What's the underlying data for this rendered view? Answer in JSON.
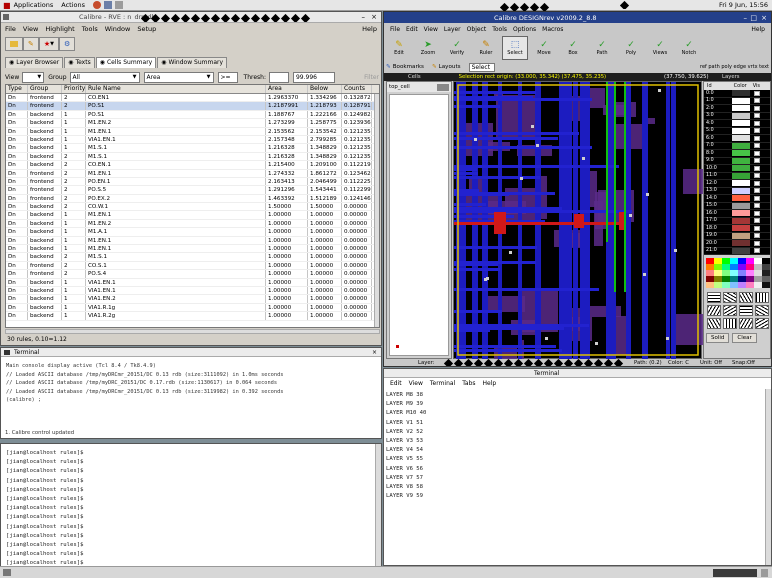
{
  "topbar": {
    "applications": "Applications",
    "actions": "Actions",
    "clock": "Fri 9 Jun, 15:56"
  },
  "rve": {
    "title": "Calibre - RVE : n",
    "title_tail": "drmdb",
    "help": "Help",
    "menu": [
      "File",
      "View",
      "Highlight",
      "Tools",
      "Window",
      "Setup"
    ],
    "tabs": [
      "Layer Browser",
      "Texts",
      "Cells Summary",
      "Window Summary"
    ],
    "filter": {
      "view_label": "View",
      "group_label": "Group",
      "group_value": "All",
      "value_col": "Area",
      "threshold_label": "Thresh:",
      "threshold_value": "99.996",
      "filter_btn": "Filter"
    },
    "columns": [
      "Type",
      "Group",
      "Priority",
      "Rule Name",
      "Area",
      "Below",
      "Counts"
    ],
    "rows": [
      [
        "Dn",
        "frontend",
        "2",
        "CO.EN1",
        "1.2963370",
        "1.334296",
        "0.132872"
      ],
      [
        "Dn",
        "frontend",
        "2",
        "PO.S1",
        "1.2187991",
        "1.218793",
        "0.128791"
      ],
      [
        "Dn",
        "backend",
        "1",
        "PO.S1",
        "1.188767",
        "1.222166",
        "0.124982"
      ],
      [
        "Dn",
        "backend",
        "1",
        "M1.EN.2",
        "1.273299",
        "1.258775",
        "0.123936"
      ],
      [
        "Dn",
        "backend",
        "1",
        "M1.EN.1",
        "2.153562",
        "2.153542",
        "0.121235"
      ],
      [
        "Dn",
        "backend",
        "1",
        "VIA1.EN.1",
        "2.157348",
        "2.799285",
        "0.121235"
      ],
      [
        "Dn",
        "backend",
        "1",
        "M1.S.1",
        "1.216328",
        "1.348829",
        "0.121235"
      ],
      [
        "Dn",
        "backend",
        "2",
        "M1.S.1",
        "1.216328",
        "1.348829",
        "0.121235"
      ],
      [
        "Dn",
        "backend",
        "2",
        "CO.EN.1",
        "1.215400",
        "1.209100",
        "0.112219"
      ],
      [
        "Dn",
        "frontend",
        "2",
        "M1.EN.1",
        "1.274332",
        "1.861272",
        "0.123462"
      ],
      [
        "Dn",
        "frontend",
        "2",
        "PO.EN.1",
        "2.163413",
        "2.046499",
        "0.112225"
      ],
      [
        "Dn",
        "frontend",
        "2",
        "PO.S.5",
        "1.291296",
        "1.543441",
        "0.112299"
      ],
      [
        "Dn",
        "frontend",
        "2",
        "PO.EX.2",
        "1.463392",
        "1.512189",
        "0.124146"
      ],
      [
        "Dn",
        "backend",
        "2",
        "CO.W.1",
        "1.50000",
        "1.50000",
        "0.00000"
      ],
      [
        "Dn",
        "backend",
        "1",
        "M1.EN.1",
        "1.00000",
        "1.00000",
        "0.00000"
      ],
      [
        "Dn",
        "backend",
        "1",
        "M1.EN.2",
        "1.00000",
        "1.00000",
        "0.00000"
      ],
      [
        "Dn",
        "backend",
        "1",
        "M1.A.1",
        "1.00000",
        "1.00000",
        "0.00000"
      ],
      [
        "Dn",
        "backend",
        "1",
        "M1.EN.1",
        "1.00000",
        "1.00000",
        "0.00000"
      ],
      [
        "Dn",
        "backend",
        "1",
        "M1.EN.1",
        "1.00000",
        "1.00000",
        "0.00000"
      ],
      [
        "Dn",
        "backend",
        "2",
        "M1.S.1",
        "1.00000",
        "1.00000",
        "0.00000"
      ],
      [
        "Dn",
        "frontend",
        "2",
        "CO.S.1",
        "1.00000",
        "1.00000",
        "0.00000"
      ],
      [
        "Dn",
        "frontend",
        "2",
        "PO.S.4",
        "1.00000",
        "1.00000",
        "0.00000"
      ],
      [
        "Dn",
        "backend",
        "1",
        "VIA1.EN.1",
        "1.00000",
        "1.00000",
        "0.00000"
      ],
      [
        "Dn",
        "backend",
        "1",
        "VIA1.EN.1",
        "1.00000",
        "1.00000",
        "0.00000"
      ],
      [
        "Dn",
        "backend",
        "1",
        "VIA1.EN.2",
        "1.00000",
        "1.00000",
        "0.00000"
      ],
      [
        "Dn",
        "backend",
        "1",
        "VIA1.R.1g",
        "1.00000",
        "1.00000",
        "0.00000"
      ],
      [
        "Dn",
        "backend",
        "1",
        "VIA1.R.2g",
        "1.00000",
        "1.00000",
        "0.00000"
      ]
    ],
    "status": "30 rules, 0.10=1.12"
  },
  "term1": {
    "title": "Terminal",
    "lines": [
      "Main console display active (Tcl 8.4 / Tk8.4.9)",
      "// Loaded ASCII database /tmp/myDRCmr_20151/DC 0.13 rdb (size:3111092) in 1.0ms seconds",
      "// Loaded ASCII database /tmp/myDRC_20151/DC 0.17.rdb (size:1130617) in 0.064 seconds",
      "// Loaded ASCII database /tmp/myDRCmr_20151/DC 0.13 rdb (size:3119982) in 0.392 seconds",
      "(calibre) ;"
    ],
    "status": "1. Calibre control updated"
  },
  "term2": {
    "lines": [
      "[jian@localhost rules]$",
      "[jian@localhost rules]$",
      "[jian@localhost rules]$",
      "[jian@localhost rules]$",
      "[jian@localhost rules]$",
      "[jian@localhost rules]$",
      "[jian@localhost rules]$",
      "[jian@localhost rules]$",
      "[jian@localhost rules]$",
      "[jian@localhost rules]$",
      "[jian@localhost rules]$",
      "[jian@localhost rules]$",
      "[jian@localhost rules]$",
      "[jian@localhost rules]$"
    ]
  },
  "term3": {
    "title": "Terminal",
    "menu": [
      "Edit",
      "View",
      "Terminal",
      "Tabs",
      "Help"
    ],
    "lines": [
      "LAYER M8 38",
      "LAYER M9 39",
      "LAYER M10 40",
      "LAYER V1 51",
      "LAYER V2 52",
      "LAYER V3 53",
      "LAYER V4 54",
      "LAYER V5 55",
      "LAYER V6 56",
      "LAYER V7 57",
      "LAYER V8 58",
      "LAYER V9 59"
    ]
  },
  "drev": {
    "title": "Calibre DESIGNrev v2009.2_8.8",
    "help": "Help",
    "menu": [
      "File",
      "Edit",
      "View",
      "Layer",
      "Object",
      "Tools",
      "Options",
      "Macros"
    ],
    "tools": [
      "Edit",
      "Zoom",
      "Verify",
      "Ruler",
      "Select",
      "Move",
      "Box",
      "Path",
      "Poly",
      "Views",
      "Notch"
    ],
    "bar2": {
      "bookmarks": "Bookmarks",
      "layouts": "Layouts",
      "select": "Select",
      "toggles": "ref  path  poly  edge  vrtx  text"
    },
    "cells_label": "Cells",
    "cell_name": "top_cell",
    "coord_left": "Selection rect origin: (33.000, 35.342) (37.475, 35.235)",
    "coord_right": "(37.750, 39.625)",
    "layers_label": "Layers",
    "layers_header": [
      "Id",
      "Color",
      "Vis"
    ],
    "layers": [
      {
        "id": "0:0",
        "color": "#2f2f2f"
      },
      {
        "id": "1:0",
        "color": "#ffffff"
      },
      {
        "id": "2:0",
        "color": "#ffffff"
      },
      {
        "id": "3:0",
        "color": "#c8c8c8"
      },
      {
        "id": "4:0",
        "color": "#ffffff"
      },
      {
        "id": "5:0",
        "color": "#ffffff"
      },
      {
        "id": "6:0",
        "color": "#e0e0e0"
      },
      {
        "id": "7:0",
        "color": "#3fae3f"
      },
      {
        "id": "8:0",
        "color": "#47c447"
      },
      {
        "id": "9:0",
        "color": "#3fb43f"
      },
      {
        "id": "10:0",
        "color": "#3fae3f"
      },
      {
        "id": "11:0",
        "color": "#36a336"
      },
      {
        "id": "12:0",
        "color": "#ffffff"
      },
      {
        "id": "13:0",
        "color": "#d0d0ff"
      },
      {
        "id": "14:0",
        "color": "#ff6040"
      },
      {
        "id": "15:0",
        "color": "#9a9a9a"
      },
      {
        "id": "16:0",
        "color": "#ff9a9a"
      },
      {
        "id": "17:0",
        "color": "#a43636"
      },
      {
        "id": "18:0",
        "color": "#c64040"
      },
      {
        "id": "19:0",
        "color": "#c0a080"
      },
      {
        "id": "20:0",
        "color": "#703030"
      },
      {
        "id": "21:0",
        "color": "#404040"
      }
    ],
    "palette": [
      "#ff0000",
      "#ffff00",
      "#00ff00",
      "#00ffff",
      "#0000ff",
      "#ff00ff",
      "#ffffff",
      "#000000",
      "#ff8000",
      "#80ff00",
      "#00ff80",
      "#0080ff",
      "#8000ff",
      "#ff0080",
      "#c0c0c0",
      "#404040",
      "#ff8080",
      "#ffff80",
      "#80ff80",
      "#80ffff",
      "#8080ff",
      "#ff80ff",
      "#e0e0e0",
      "#202020",
      "#800000",
      "#808000",
      "#008000",
      "#008080",
      "#000080",
      "#800080",
      "#a0a0a0",
      "#606060",
      "#ffc080",
      "#c0ff80",
      "#80ffc0",
      "#80c0ff",
      "#c080ff",
      "#ff80c0",
      "#f0f0f0",
      "#101010"
    ],
    "solid_btn": "Solid",
    "clear_btn": "Clear",
    "status_layer": "Layer:",
    "status_path": "Path: (0.2)",
    "status_color": "Color: C",
    "status_unit": "Unit: Off",
    "status_snap": "Snap:Off"
  }
}
